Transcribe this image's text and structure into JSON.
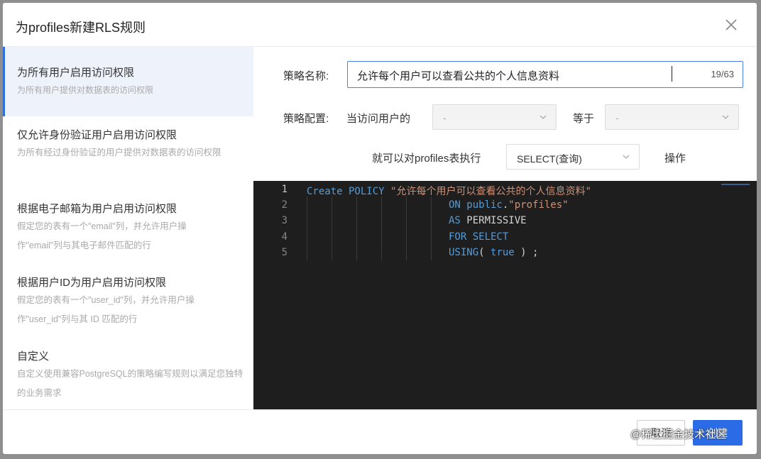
{
  "dialog": {
    "title": "为profiles新建RLS规则"
  },
  "sidebar": {
    "items": [
      {
        "title": "为所有用户启用访问权限",
        "desc": "为所有用户提供对数据表的访问权限",
        "active": true
      },
      {
        "title": "仅允许身份验证用户启用访问权限",
        "desc": "为所有经过身份验证的用户提供对数据表的访问权限"
      },
      {
        "title": "根据电子邮箱为用户启用访问权限",
        "desc": "假定您的表有一个\"email\"列，并允许用户操作\"email\"列与其电子邮件匹配的行"
      },
      {
        "title": "根据用户ID为用户启用访问权限",
        "desc": "假定您的表有一个\"user_id\"列，并允许用户操作\"user_id\"列与其 ID 匹配的行"
      },
      {
        "title": "自定义",
        "desc": "自定义使用兼容PostgreSQL的策略编写规则以满足您独特的业务需求"
      }
    ]
  },
  "form": {
    "name_label": "策略名称:",
    "name_value": "允许每个用户可以查看公共的个人信息资料",
    "name_count": "19/63",
    "config_label": "策略配置:",
    "when_user_label": "当访问用户的",
    "user_field_value": "-",
    "equals_label": "等于",
    "equals_value": "-",
    "can_execute_label": "就可以对profiles表执行",
    "operation_value": "SELECT(查询)",
    "operation_label": "操作"
  },
  "editor": {
    "line_numbers": [
      "1",
      "2",
      "3",
      "4",
      "5"
    ],
    "lines": [
      [
        {
          "t": "Create POLICY ",
          "c": "kw"
        },
        {
          "t": "\"允许每个用户可以查看公共的个人信息资料\"",
          "c": "str"
        }
      ],
      [
        {
          "t": "ON public",
          "c": "kw"
        },
        {
          "t": ".",
          "c": ""
        },
        {
          "t": "\"profiles\"",
          "c": "str"
        }
      ],
      [
        {
          "t": "AS ",
          "c": "kw"
        },
        {
          "t": "PERMISSIVE",
          "c": ""
        }
      ],
      [
        {
          "t": "FOR SELECT",
          "c": "kw"
        }
      ],
      [
        {
          "t": "USING",
          "c": "kw"
        },
        {
          "t": "( ",
          "c": ""
        },
        {
          "t": "true",
          "c": "kw"
        },
        {
          "t": " ) ;",
          "c": ""
        }
      ]
    ]
  },
  "footer": {
    "cancel_label": "取消",
    "create_label": "创建",
    "credit": "@稀土掘金技术社区"
  },
  "colors": {
    "primary": "#2b6be6",
    "active_bg": "#eef3fb",
    "editor_bg": "#1e1e1e",
    "keyword": "#569cd6",
    "string": "#ce9178"
  },
  "icons": {
    "close": "close-icon",
    "chevron": "chevron-down-icon"
  }
}
